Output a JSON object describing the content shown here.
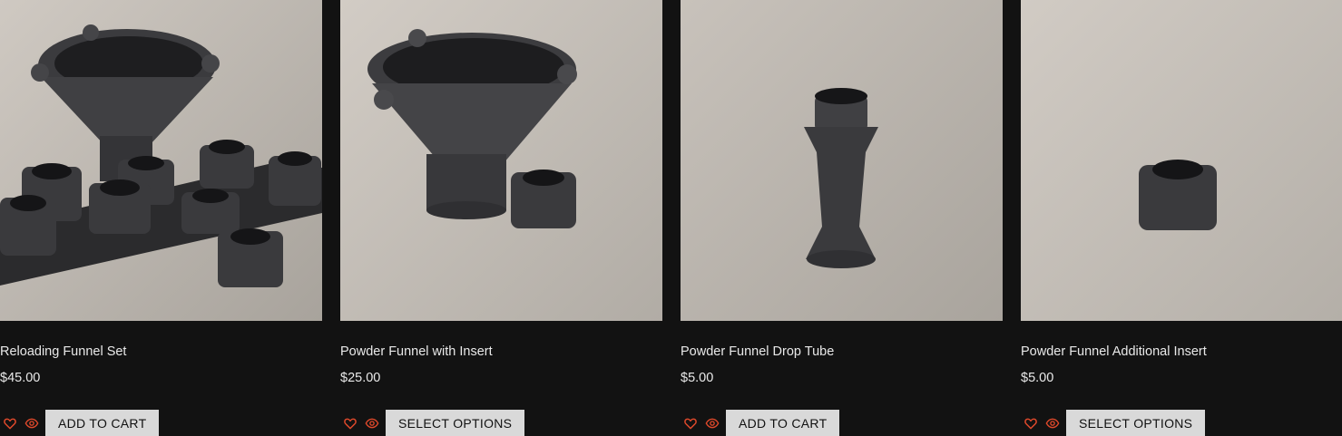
{
  "accent_color": "#e0492b",
  "products": [
    {
      "title": "Reloading Funnel Set",
      "price": "$45.00",
      "button_label": "ADD TO CART",
      "wishlist_icon": "heart-icon",
      "quickview_icon": "eye-icon"
    },
    {
      "title": "Powder Funnel with Insert",
      "price": "$25.00",
      "button_label": "SELECT OPTIONS",
      "wishlist_icon": "heart-icon",
      "quickview_icon": "eye-icon"
    },
    {
      "title": "Powder Funnel Drop Tube",
      "price": "$5.00",
      "button_label": "ADD TO CART",
      "wishlist_icon": "heart-icon",
      "quickview_icon": "eye-icon"
    },
    {
      "title": "Powder Funnel Additional Insert",
      "price": "$5.00",
      "button_label": "SELECT OPTIONS",
      "wishlist_icon": "heart-icon",
      "quickview_icon": "eye-icon"
    }
  ]
}
